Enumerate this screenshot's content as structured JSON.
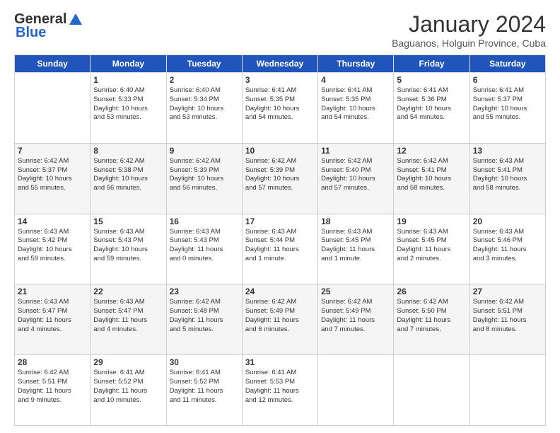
{
  "logo": {
    "general": "General",
    "blue": "Blue"
  },
  "header": {
    "month_year": "January 2024",
    "location": "Baguanos, Holguin Province, Cuba"
  },
  "days_of_week": [
    "Sunday",
    "Monday",
    "Tuesday",
    "Wednesday",
    "Thursday",
    "Friday",
    "Saturday"
  ],
  "weeks": [
    [
      {
        "day": "",
        "content": ""
      },
      {
        "day": "1",
        "content": "Sunrise: 6:40 AM\nSunset: 5:33 PM\nDaylight: 10 hours\nand 53 minutes."
      },
      {
        "day": "2",
        "content": "Sunrise: 6:40 AM\nSunset: 5:34 PM\nDaylight: 10 hours\nand 53 minutes."
      },
      {
        "day": "3",
        "content": "Sunrise: 6:41 AM\nSunset: 5:35 PM\nDaylight: 10 hours\nand 54 minutes."
      },
      {
        "day": "4",
        "content": "Sunrise: 6:41 AM\nSunset: 5:35 PM\nDaylight: 10 hours\nand 54 minutes."
      },
      {
        "day": "5",
        "content": "Sunrise: 6:41 AM\nSunset: 5:36 PM\nDaylight: 10 hours\nand 54 minutes."
      },
      {
        "day": "6",
        "content": "Sunrise: 6:41 AM\nSunset: 5:37 PM\nDaylight: 10 hours\nand 55 minutes."
      }
    ],
    [
      {
        "day": "7",
        "content": "Sunrise: 6:42 AM\nSunset: 5:37 PM\nDaylight: 10 hours\nand 55 minutes."
      },
      {
        "day": "8",
        "content": "Sunrise: 6:42 AM\nSunset: 5:38 PM\nDaylight: 10 hours\nand 56 minutes."
      },
      {
        "day": "9",
        "content": "Sunrise: 6:42 AM\nSunset: 5:39 PM\nDaylight: 10 hours\nand 56 minutes."
      },
      {
        "day": "10",
        "content": "Sunrise: 6:42 AM\nSunset: 5:39 PM\nDaylight: 10 hours\nand 57 minutes."
      },
      {
        "day": "11",
        "content": "Sunrise: 6:42 AM\nSunset: 5:40 PM\nDaylight: 10 hours\nand 57 minutes."
      },
      {
        "day": "12",
        "content": "Sunrise: 6:42 AM\nSunset: 5:41 PM\nDaylight: 10 hours\nand 58 minutes."
      },
      {
        "day": "13",
        "content": "Sunrise: 6:43 AM\nSunset: 5:41 PM\nDaylight: 10 hours\nand 58 minutes."
      }
    ],
    [
      {
        "day": "14",
        "content": "Sunrise: 6:43 AM\nSunset: 5:42 PM\nDaylight: 10 hours\nand 59 minutes."
      },
      {
        "day": "15",
        "content": "Sunrise: 6:43 AM\nSunset: 5:43 PM\nDaylight: 10 hours\nand 59 minutes."
      },
      {
        "day": "16",
        "content": "Sunrise: 6:43 AM\nSunset: 5:43 PM\nDaylight: 11 hours\nand 0 minutes."
      },
      {
        "day": "17",
        "content": "Sunrise: 6:43 AM\nSunset: 5:44 PM\nDaylight: 11 hours\nand 1 minute."
      },
      {
        "day": "18",
        "content": "Sunrise: 6:43 AM\nSunset: 5:45 PM\nDaylight: 11 hours\nand 1 minute."
      },
      {
        "day": "19",
        "content": "Sunrise: 6:43 AM\nSunset: 5:45 PM\nDaylight: 11 hours\nand 2 minutes."
      },
      {
        "day": "20",
        "content": "Sunrise: 6:43 AM\nSunset: 5:46 PM\nDaylight: 11 hours\nand 3 minutes."
      }
    ],
    [
      {
        "day": "21",
        "content": "Sunrise: 6:43 AM\nSunset: 5:47 PM\nDaylight: 11 hours\nand 4 minutes."
      },
      {
        "day": "22",
        "content": "Sunrise: 6:43 AM\nSunset: 5:47 PM\nDaylight: 11 hours\nand 4 minutes."
      },
      {
        "day": "23",
        "content": "Sunrise: 6:42 AM\nSunset: 5:48 PM\nDaylight: 11 hours\nand 5 minutes."
      },
      {
        "day": "24",
        "content": "Sunrise: 6:42 AM\nSunset: 5:49 PM\nDaylight: 11 hours\nand 6 minutes."
      },
      {
        "day": "25",
        "content": "Sunrise: 6:42 AM\nSunset: 5:49 PM\nDaylight: 11 hours\nand 7 minutes."
      },
      {
        "day": "26",
        "content": "Sunrise: 6:42 AM\nSunset: 5:50 PM\nDaylight: 11 hours\nand 7 minutes."
      },
      {
        "day": "27",
        "content": "Sunrise: 6:42 AM\nSunset: 5:51 PM\nDaylight: 11 hours\nand 8 minutes."
      }
    ],
    [
      {
        "day": "28",
        "content": "Sunrise: 6:42 AM\nSunset: 5:51 PM\nDaylight: 11 hours\nand 9 minutes."
      },
      {
        "day": "29",
        "content": "Sunrise: 6:41 AM\nSunset: 5:52 PM\nDaylight: 11 hours\nand 10 minutes."
      },
      {
        "day": "30",
        "content": "Sunrise: 6:41 AM\nSunset: 5:52 PM\nDaylight: 11 hours\nand 11 minutes."
      },
      {
        "day": "31",
        "content": "Sunrise: 6:41 AM\nSunset: 5:53 PM\nDaylight: 11 hours\nand 12 minutes."
      },
      {
        "day": "",
        "content": ""
      },
      {
        "day": "",
        "content": ""
      },
      {
        "day": "",
        "content": ""
      }
    ]
  ]
}
